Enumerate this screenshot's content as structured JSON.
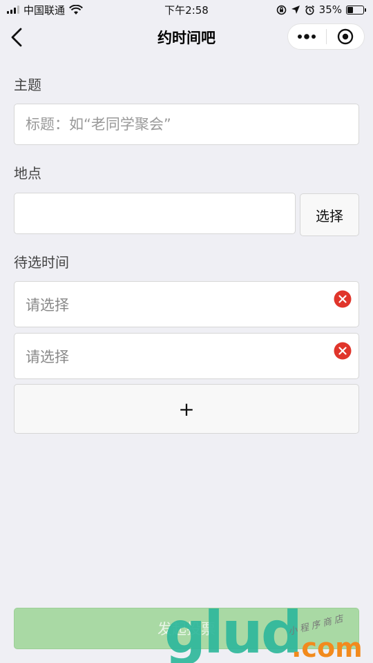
{
  "status_bar": {
    "carrier": "中国联通",
    "time": "下午2:58",
    "battery": "35%",
    "icons": [
      "signal-icon",
      "wifi-icon",
      "orientation-lock-icon",
      "location-icon",
      "alarm-icon",
      "battery-icon"
    ]
  },
  "nav": {
    "title": "约时间吧",
    "back_icon": "back-arrow-icon",
    "menu_icon": "more-dots-icon",
    "close_icon": "target-close-icon"
  },
  "form": {
    "topic": {
      "label": "主题",
      "placeholder": "标题：如“老同学聚会”"
    },
    "location": {
      "label": "地点",
      "value": "",
      "select_label": "选择"
    },
    "times": {
      "label": "待选时间",
      "items": [
        {
          "placeholder": "请选择"
        },
        {
          "placeholder": "请选择"
        }
      ],
      "add_label": "+"
    },
    "submit_label": "发起投票"
  },
  "watermark": {
    "main": "glud",
    "suffix": ".com",
    "cn": "小程序商店"
  },
  "colors": {
    "background": "#efeff4",
    "submit_bg": "#a9d9a4",
    "clear_red": "#e0352b",
    "watermark_teal": "#2fb89c",
    "watermark_orange": "#f28a1d"
  }
}
